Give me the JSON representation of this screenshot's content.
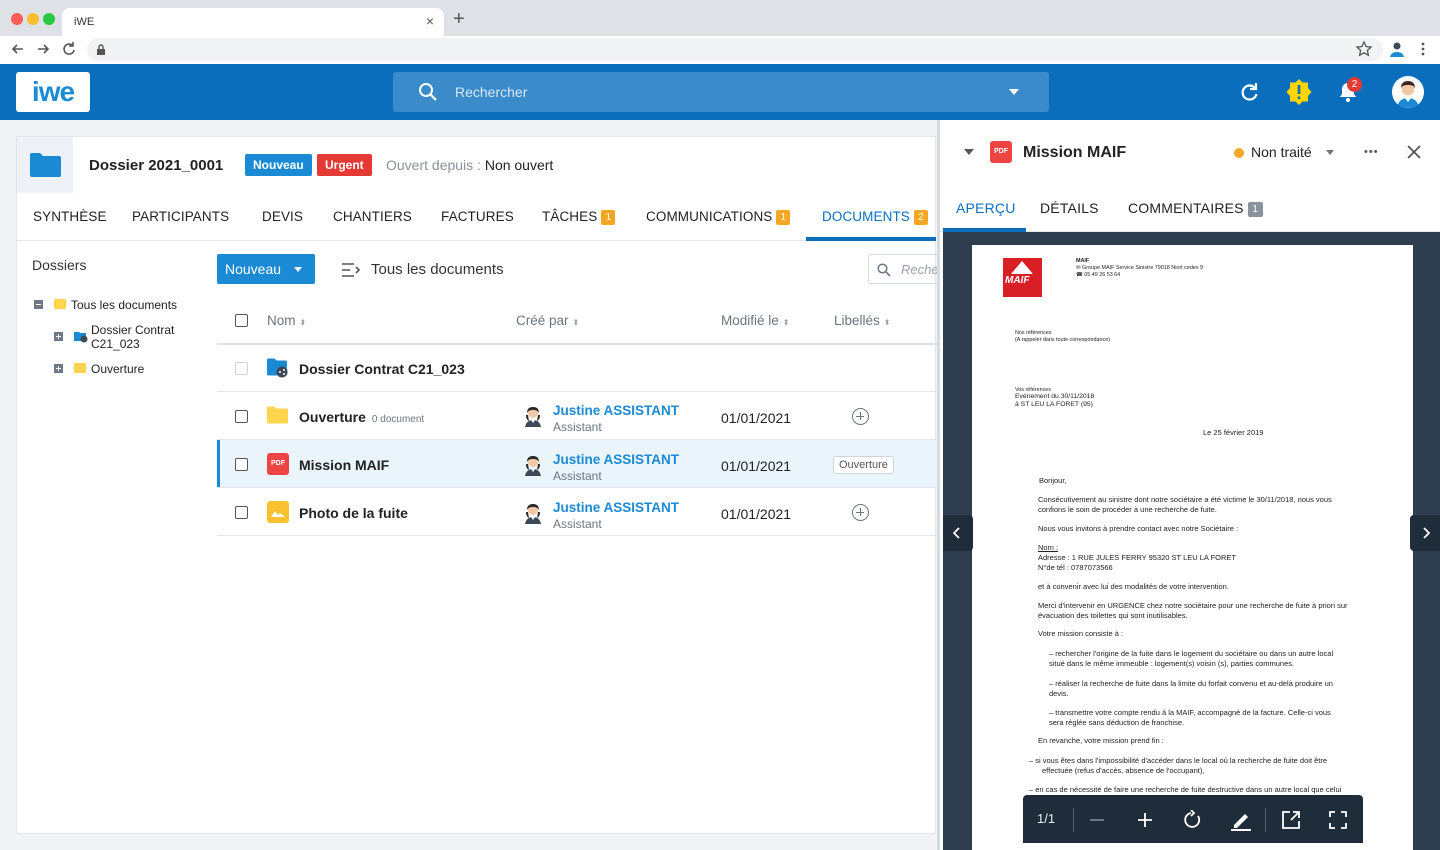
{
  "browser": {
    "tab_title": "iWE",
    "tab_close": "×",
    "new_tab": "+"
  },
  "header": {
    "logo": "iwe",
    "search_placeholder": "Rechercher",
    "notifications_count": "2"
  },
  "dossier": {
    "title": "Dossier 2021_0001",
    "tags": [
      {
        "label": "Nouveau",
        "color": "#1a8ad4"
      },
      {
        "label": "Urgent",
        "color": "#e53935"
      }
    ],
    "since_label": "Ouvert depuis :",
    "since_value": "Non ouvert"
  },
  "tabs": [
    {
      "label": "SYNTHÈSE"
    },
    {
      "label": "PARTICIPANTS"
    },
    {
      "label": "DEVIS"
    },
    {
      "label": "CHANTIERS"
    },
    {
      "label": "FACTURES"
    },
    {
      "label": "TÂCHES",
      "count": "1"
    },
    {
      "label": "COMMUNICATIONS",
      "count": "1"
    },
    {
      "label": "DOCUMENTS",
      "count": "2",
      "active": true
    }
  ],
  "sidebar": {
    "title": "Dossiers",
    "tree": [
      {
        "label": "Tous les documents"
      },
      {
        "label_line1": "Dossier Contrat",
        "label_line2": "C21_023"
      },
      {
        "label": "Ouverture"
      }
    ]
  },
  "toolbar": {
    "new_button": "Nouveau",
    "filter_label": "Tous les documents",
    "search_placeholder": "Reche"
  },
  "table": {
    "columns": [
      "Nom",
      "Créé par",
      "Modifié le",
      "Libellés"
    ],
    "rows": [
      {
        "name": "Dossier Contrat C21_023"
      },
      {
        "name": "Ouverture",
        "sub": "0 document",
        "creator": "Justine ASSISTANT",
        "role": "Assistant",
        "date": "01/01/2021"
      },
      {
        "name": "Mission MAIF",
        "file_type": "PDF",
        "creator": "Justine ASSISTANT",
        "role": "Assistant",
        "date": "01/01/2021",
        "label": "Ouverture"
      },
      {
        "name": "Photo de la fuite",
        "creator": "Justine ASSISTANT",
        "role": "Assistant",
        "date": "01/01/2021"
      }
    ]
  },
  "preview": {
    "file_type": "PDF",
    "title": "Mission MAIF",
    "status": "Non traité",
    "more": "•••",
    "tabs": [
      {
        "label": "APERÇU",
        "active": true
      },
      {
        "label": "DÉTAILS"
      },
      {
        "label": "COMMENTAIRES",
        "count": "1"
      }
    ],
    "page_indicator": "1/1",
    "document": {
      "logo": "MAIF",
      "sender": [
        "MAIF",
        "✉ Groupe MAIF Service Sinistre   79018 Niort cedex 9",
        "☎ 05 49 26 53 64"
      ],
      "ref": [
        "Nos références",
        "(A rappeler dans toute correspondance)"
      ],
      "vref": [
        "Vos références",
        "     Evénement du 30/11/2018",
        "     à ST LEU LA FORET (95)"
      ],
      "date": "Le 25 février 2019",
      "salutation": "Bonjour,",
      "para1": [
        "Consécutivement au sinistre dont notre sociétaire a été victime le 30/11/2018, nous vous",
        "confions le soin de procéder à une recherche de fuite."
      ],
      "para2": "Nous vous invitons à prendre contact avec notre Sociétaire :",
      "contact": [
        "Nom :",
        "Adresse :  1 RUE JULES FERRY 95320 ST LEU LA FORET",
        "N°de tél :  0787073566"
      ],
      "para3": "et à convenir avec lui des modalités de votre intervention.",
      "para4": [
        "Merci d'intervenir en URGENCE chez notre sociétaire  pour une recherche de fuite à priori sur",
        "évacuation des toilettes qui sont inutilisables."
      ],
      "para5": "Votre mission consiste à :",
      "bullet1": [
        "–      rechercher l'origine de la fuite dans le logement du sociétaire ou dans un autre local",
        "situé dans le même immeuble : logement(s) voisin (s), parties communes."
      ],
      "bullet2": [
        "–      réaliser la recherche de fuite dans la limite du forfait convenu et au-delà produire un",
        "devis."
      ],
      "bullet3": [
        "–      transmettre votre compte rendu à la MAIF, accompagné de la facture. Celle-ci vous",
        "sera réglée sans déduction de franchise."
      ],
      "para6": "En revanche, votre mission prend fin :",
      "end1": [
        "–     si vous êtes dans l'impossibilité d'accéder dans le local où la recherche de fuite doit être",
        "effectuée (refus d'accès, absence de l'occupant),"
      ],
      "end2": "–     en cas de nécessité de faire une recherche de fuite destructive dans un autre local que celui"
    }
  }
}
